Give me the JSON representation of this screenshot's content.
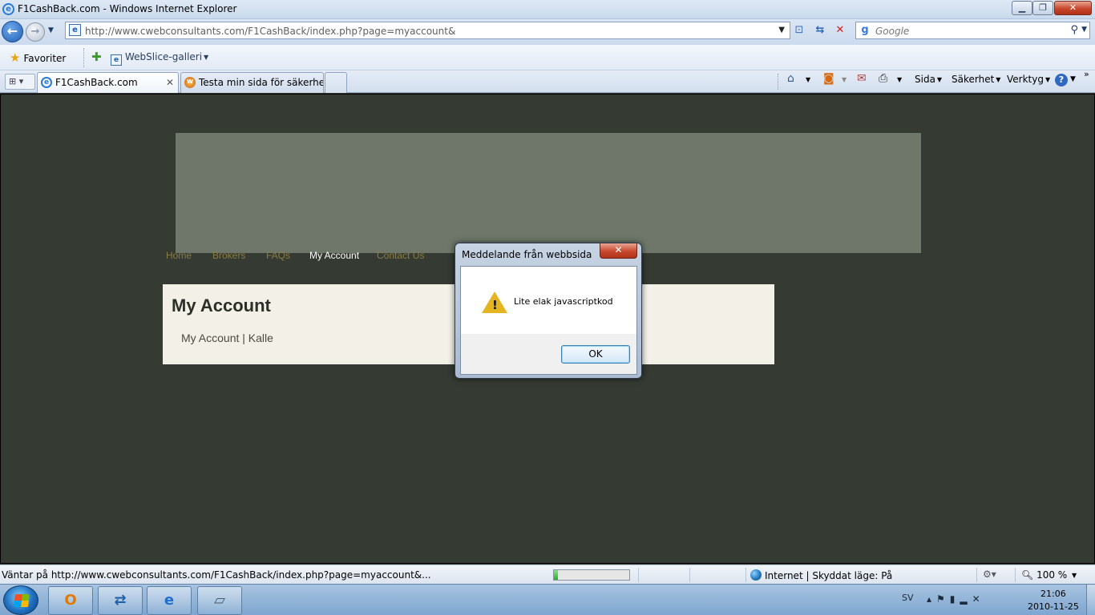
{
  "window": {
    "title": "F1CashBack.com - Windows Internet Explorer",
    "min_glyph": "▁",
    "max_glyph": "❐",
    "close_glyph": "✕"
  },
  "address_bar": {
    "url": "http://www.cwebconsultants.com/F1CashBack/index.php?page=myaccount&",
    "search_placeholder": "Google"
  },
  "favorites_bar": {
    "favorites_label": "Favoriter",
    "webslice_label": "WebSlice-galleri"
  },
  "tabs": [
    {
      "label": "F1CashBack.com",
      "active": true
    },
    {
      "label": "Testa min sida för säkerhet..."
    }
  ],
  "command_bar": {
    "page_label": "Sida",
    "safety_label": "Säkerhet",
    "tools_label": "Verktyg"
  },
  "page": {
    "nav": [
      {
        "label": "Home"
      },
      {
        "label": "Brokers"
      },
      {
        "label": "FAQs"
      },
      {
        "label": "My Account"
      },
      {
        "label": "Contact Us"
      }
    ],
    "heading": "My Account",
    "account_line": "My Account | Kalle",
    "colors": {
      "background": "#353a32",
      "banner": "#6e776a",
      "nav_link": "#8a7d42",
      "nav_active": "#ffffff",
      "panel": "#f3f0e8"
    }
  },
  "dialog": {
    "title": "Meddelande från webbsida",
    "message": "Lite elak javascriptkod",
    "ok_label": "OK",
    "icon": "warning-icon"
  },
  "status_bar": {
    "text": "Väntar på http://www.cwebconsultants.com/F1CashBack/index.php?page=myaccount&...",
    "progress": 0.05,
    "zone": "Internet | Skyddat läge: På",
    "zoom": "100 %"
  },
  "taskbar": {
    "language": "SV",
    "time": "21:06",
    "date": "2010-11-25"
  }
}
